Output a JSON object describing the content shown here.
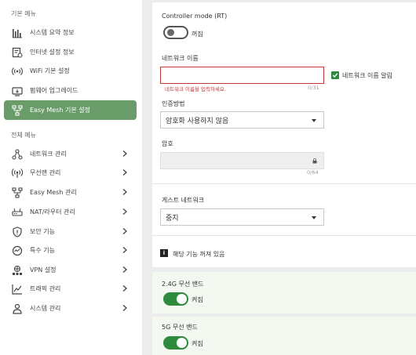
{
  "sidebar": {
    "basic_section": "기본 메뉴",
    "full_section": "전체 메뉴",
    "basic_items": [
      {
        "label": "시스템 요약 정보",
        "icon": "bar-chart-icon"
      },
      {
        "label": "인터넷 설정 정보",
        "icon": "settings-doc-icon"
      },
      {
        "label": "WiFi 기본 설정",
        "icon": "wifi-icon"
      },
      {
        "label": "펌웨어 업그레이드",
        "icon": "firmware-icon"
      },
      {
        "label": "Easy Mesh 기본 설정",
        "icon": "mesh-icon"
      }
    ],
    "full_items": [
      {
        "label": "네트워크 관리",
        "icon": "network-icon"
      },
      {
        "label": "무선랜 관리",
        "icon": "wireless-icon"
      },
      {
        "label": "Easy Mesh 관리",
        "icon": "mesh-icon"
      },
      {
        "label": "NAT/라우터 관리",
        "icon": "router-icon"
      },
      {
        "label": "보안 기능",
        "icon": "shield-icon"
      },
      {
        "label": "특수 기능",
        "icon": "special-icon"
      },
      {
        "label": "VPN 설정",
        "icon": "vpn-icon"
      },
      {
        "label": "트래픽 관리",
        "icon": "traffic-icon"
      },
      {
        "label": "시스템 관리",
        "icon": "system-icon"
      }
    ],
    "active_item": "Easy Mesh 기본 설정",
    "active_color": "#6a9c6a"
  },
  "main": {
    "controller_mode_label": "Controller mode (RT)",
    "controller_mode_state": "꺼짐",
    "network_name_label": "네트워크 이름",
    "network_name_value": "",
    "network_name_error": "네트워크 이름을 입력하세요.",
    "network_name_counter": "0/31",
    "network_name_hide_label": "네트워크 이름 알림",
    "auth_label": "인증방법",
    "auth_value": "암호화 사용하지 않음",
    "password_label": "암호",
    "password_counter": "0/64",
    "guest_network_label": "게스트 네트워크",
    "guest_network_value": "중지",
    "info_icon_text": "i",
    "info_text": "해당 기능 꺼져 있음",
    "band_24_label": "2.4G 무선 밴드",
    "band_24_state": "켜짐",
    "band_5_label": "5G 무선 밴드",
    "band_5_state": "켜짐"
  },
  "colors": {
    "accent": "#2e8b3e",
    "error": "#c23a3a",
    "band_bg": "#f3f8f0"
  }
}
